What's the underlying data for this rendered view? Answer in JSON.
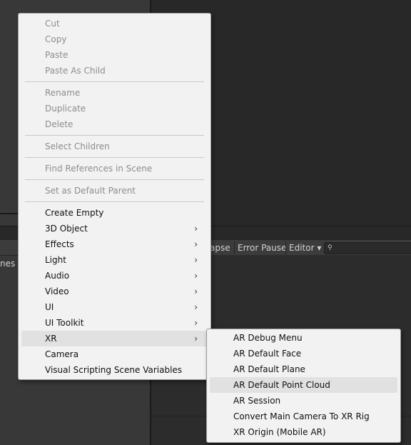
{
  "context_menu": {
    "groups": [
      [
        {
          "label": "Cut",
          "enabled": false
        },
        {
          "label": "Copy",
          "enabled": false
        },
        {
          "label": "Paste",
          "enabled": false
        },
        {
          "label": "Paste As Child",
          "enabled": false
        }
      ],
      [
        {
          "label": "Rename",
          "enabled": false
        },
        {
          "label": "Duplicate",
          "enabled": false
        },
        {
          "label": "Delete",
          "enabled": false
        }
      ],
      [
        {
          "label": "Select Children",
          "enabled": false
        }
      ],
      [
        {
          "label": "Find References in Scene",
          "enabled": false
        }
      ],
      [
        {
          "label": "Set as Default Parent",
          "enabled": false
        }
      ],
      [
        {
          "label": "Create Empty",
          "enabled": true
        },
        {
          "label": "3D Object",
          "enabled": true,
          "submenu": true
        },
        {
          "label": "Effects",
          "enabled": true,
          "submenu": true
        },
        {
          "label": "Light",
          "enabled": true,
          "submenu": true
        },
        {
          "label": "Audio",
          "enabled": true,
          "submenu": true
        },
        {
          "label": "Video",
          "enabled": true,
          "submenu": true
        },
        {
          "label": "UI",
          "enabled": true,
          "submenu": true
        },
        {
          "label": "UI Toolkit",
          "enabled": true,
          "submenu": true
        },
        {
          "label": "XR",
          "enabled": true,
          "submenu": true,
          "highlighted": true
        },
        {
          "label": "Camera",
          "enabled": true
        },
        {
          "label": "Visual Scripting Scene Variables",
          "enabled": true
        }
      ]
    ],
    "submenu_arrow": "›"
  },
  "xr_submenu": {
    "items": [
      {
        "label": "AR Debug Menu"
      },
      {
        "label": "AR Default Face"
      },
      {
        "label": "AR Default Plane"
      },
      {
        "label": "AR Default Point Cloud",
        "highlighted": true
      },
      {
        "label": "AR Session"
      },
      {
        "label": "Convert Main Camera To XR Rig"
      },
      {
        "label": "XR Origin (Mobile AR)"
      }
    ]
  },
  "console_toolbar": {
    "collapse_partial": "apse",
    "error_pause": "Error Pause",
    "editor": "Editor",
    "editor_arrow": "▾",
    "search_icon": "magnifier-icon",
    "search_glyph": "⚲"
  },
  "hierarchy_partial_text": "nes"
}
